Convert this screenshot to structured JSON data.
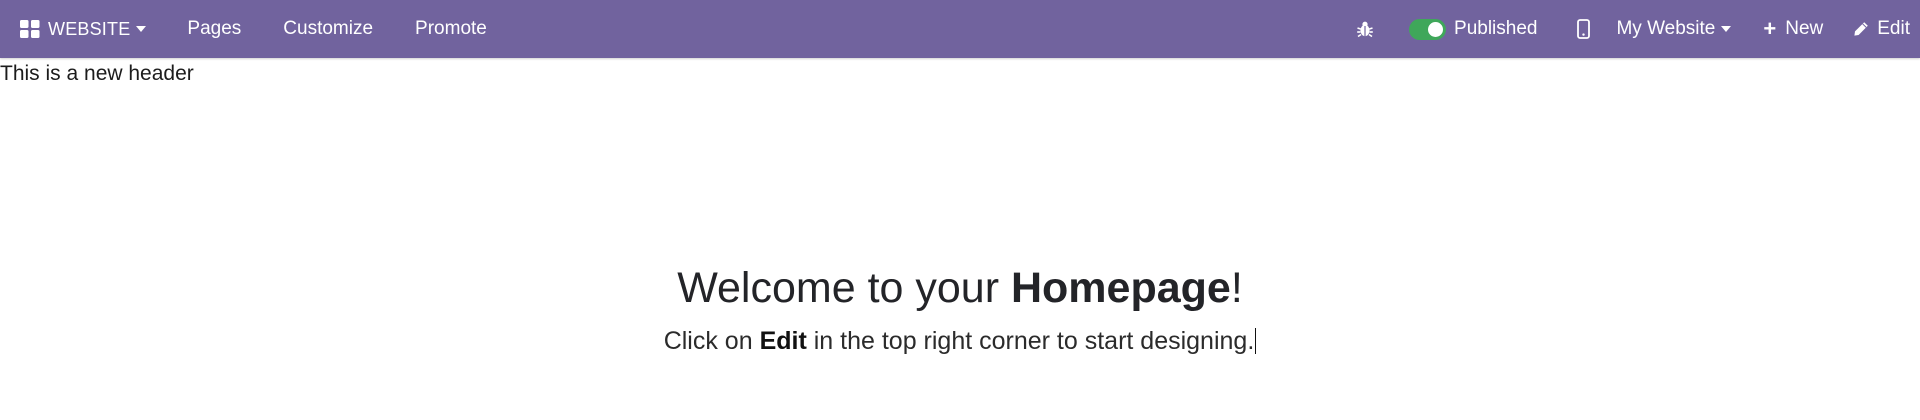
{
  "navbar": {
    "background": "#71639e",
    "brand_label": "WEBSITE",
    "menu": [
      {
        "label": "Pages"
      },
      {
        "label": "Customize"
      },
      {
        "label": "Promote"
      }
    ],
    "debug_icon": "bug-icon",
    "publish_toggle": {
      "label": "Published",
      "on": true,
      "color": "#3fa75a"
    },
    "mobile_preview_icon": "mobile-phone-icon",
    "website_switcher_label": "My Website",
    "new_label": "New",
    "edit_label": "Edit"
  },
  "page": {
    "custom_header_text": "This is a new header",
    "hero": {
      "title_prefix": "Welcome to your ",
      "title_bold": "Homepage",
      "title_suffix": "!",
      "subtitle_prefix": "Click on ",
      "subtitle_bold": "Edit",
      "subtitle_suffix": " in the top right corner to start designing."
    }
  }
}
